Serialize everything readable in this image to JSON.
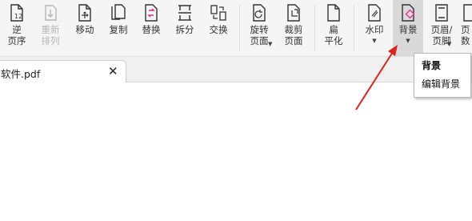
{
  "toolbar": {
    "items": [
      {
        "label": "逆\n页序",
        "icon": "reverse-pages-icon",
        "enabled": true
      },
      {
        "label": "重新\n排列",
        "icon": "rearrange-icon",
        "enabled": false
      },
      {
        "label": "移动",
        "icon": "move-page-icon",
        "enabled": true
      },
      {
        "label": "复制",
        "icon": "copy-page-icon",
        "enabled": true
      },
      {
        "label": "替换",
        "icon": "replace-page-icon",
        "enabled": true
      },
      {
        "label": "拆分",
        "icon": "split-icon",
        "enabled": true
      },
      {
        "label": "交换",
        "icon": "swap-pages-icon",
        "enabled": true
      },
      {
        "label": "旋转\n页面",
        "icon": "rotate-page-icon",
        "enabled": true,
        "dropdown": true
      },
      {
        "label": "裁剪\n页面",
        "icon": "crop-page-icon",
        "enabled": true
      },
      {
        "label": "扁\n平化",
        "icon": "flatten-icon",
        "enabled": true
      },
      {
        "label": "水印",
        "icon": "watermark-icon",
        "enabled": true,
        "dropdown": true
      },
      {
        "label": "背景",
        "icon": "background-icon",
        "enabled": true,
        "dropdown": true,
        "active": true
      },
      {
        "label": "页眉/\n页脚",
        "icon": "header-footer-icon",
        "enabled": true,
        "dropdown": true
      },
      {
        "label": "页\n数",
        "icon": "page-number-icon",
        "enabled": true
      }
    ]
  },
  "tab": {
    "title": "软件.pdf",
    "close": "✕"
  },
  "tooltip": {
    "title": "背景",
    "description": "编辑背景"
  },
  "colors": {
    "accent": "#d63384",
    "arrow": "#e02020",
    "toolbar_bg": "#f5f5f5"
  }
}
